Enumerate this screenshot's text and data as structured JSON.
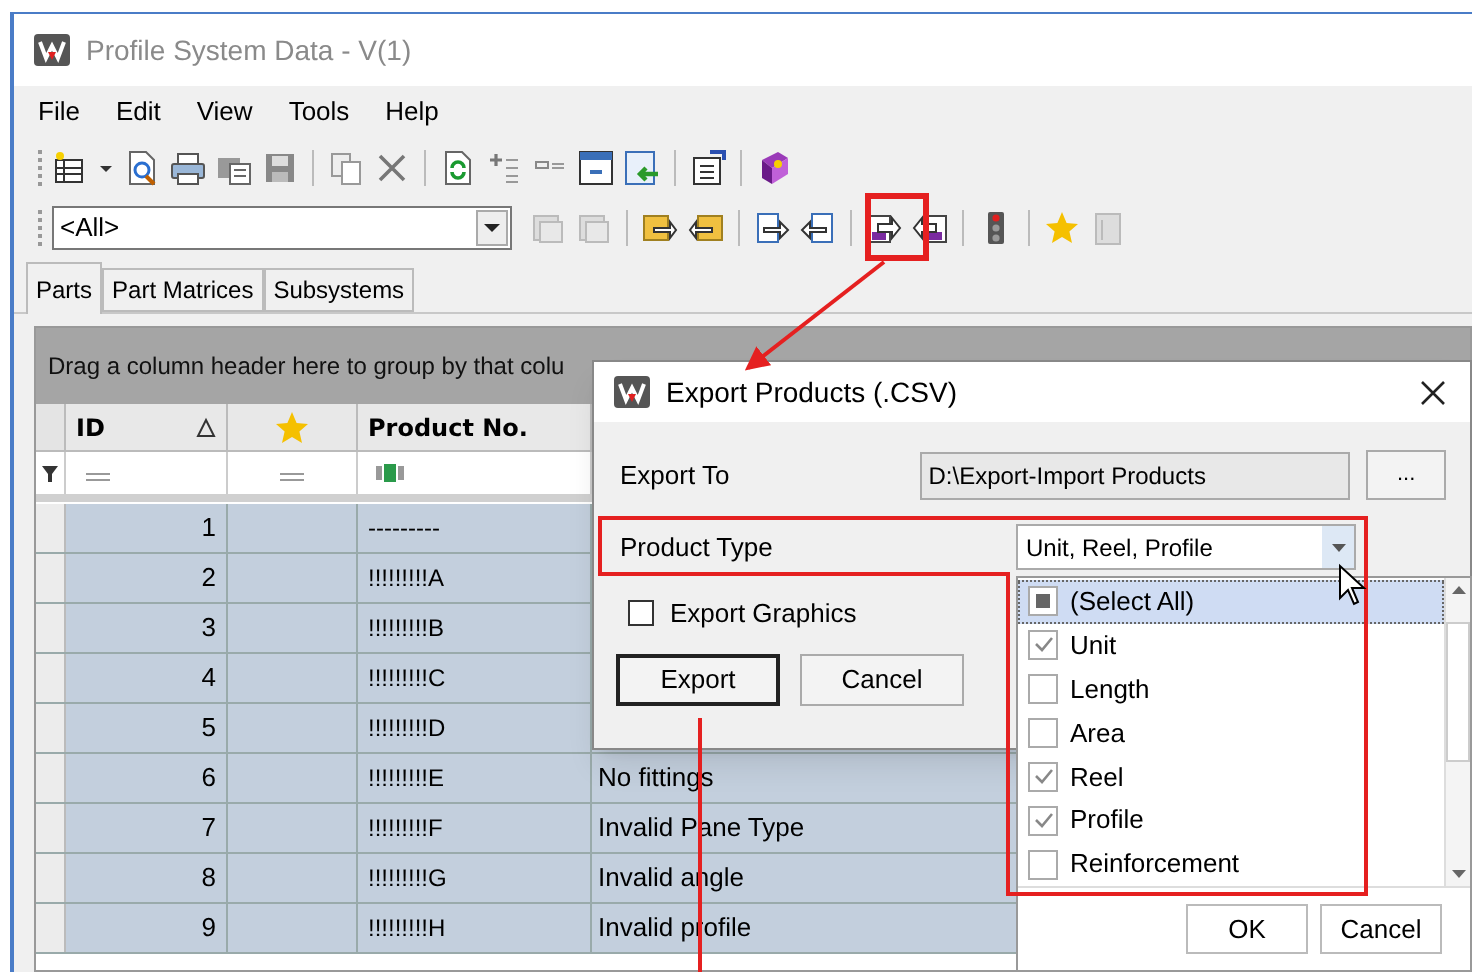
{
  "window": {
    "title": "Profile System Data - V(1)"
  },
  "menu": [
    "File",
    "Edit",
    "View",
    "Tools",
    "Help"
  ],
  "filter_combo": {
    "value": "<All>"
  },
  "tabs": [
    {
      "label": "Parts",
      "selected": true
    },
    {
      "label": "Part Matrices",
      "selected": false
    },
    {
      "label": "Subsystems",
      "selected": false
    }
  ],
  "grid": {
    "group_panel": "Drag a column header here to group by that colu",
    "columns": [
      {
        "kind": "text",
        "label": "ID",
        "sorted": true
      },
      {
        "kind": "star"
      },
      {
        "kind": "text",
        "label": "Product No.",
        "sorted": false
      }
    ],
    "rows": [
      {
        "id": "1",
        "product_no": "---------"
      },
      {
        "id": "2",
        "product_no": "!!!!!!!!!A"
      },
      {
        "id": "3",
        "product_no": "!!!!!!!!!B"
      },
      {
        "id": "4",
        "product_no": "!!!!!!!!!C"
      },
      {
        "id": "5",
        "product_no": "!!!!!!!!!D"
      },
      {
        "id": "6",
        "product_no": "!!!!!!!!!E",
        "column_4": "No fittings"
      },
      {
        "id": "7",
        "product_no": "!!!!!!!!!F",
        "column_4": "Invalid Pane Type"
      },
      {
        "id": "8",
        "product_no": "!!!!!!!!!G",
        "column_4": "Invalid angle"
      },
      {
        "id": "9",
        "product_no": "!!!!!!!!!H",
        "column_4": "Invalid profile"
      }
    ]
  },
  "dialog": {
    "title": "Export Products (.CSV)",
    "export_to_label": "Export To",
    "export_to_value": "D:\\Export-Import Products",
    "browse_button": "...",
    "product_type_label": "Product Type",
    "product_type_value": "Unit, Reel, Profile",
    "export_graphics": {
      "label": "Export Graphics",
      "checked": false
    },
    "buttons": [
      "Export",
      "Cancel"
    ]
  },
  "dropdown": {
    "items": [
      {
        "label": "(Select All)",
        "checked": true,
        "partial": true,
        "selected": true
      },
      {
        "label": "Unit",
        "checked": true,
        "selected": false
      },
      {
        "label": "Length",
        "checked": false,
        "selected": false
      },
      {
        "label": "Area",
        "checked": false,
        "selected": false
      },
      {
        "label": "Reel",
        "checked": true,
        "selected": false
      },
      {
        "label": "Profile",
        "checked": true,
        "selected": false
      },
      {
        "label": "Reinforcement",
        "checked": false,
        "selected": false
      }
    ],
    "buttons": [
      "OK",
      "Cancel"
    ]
  }
}
